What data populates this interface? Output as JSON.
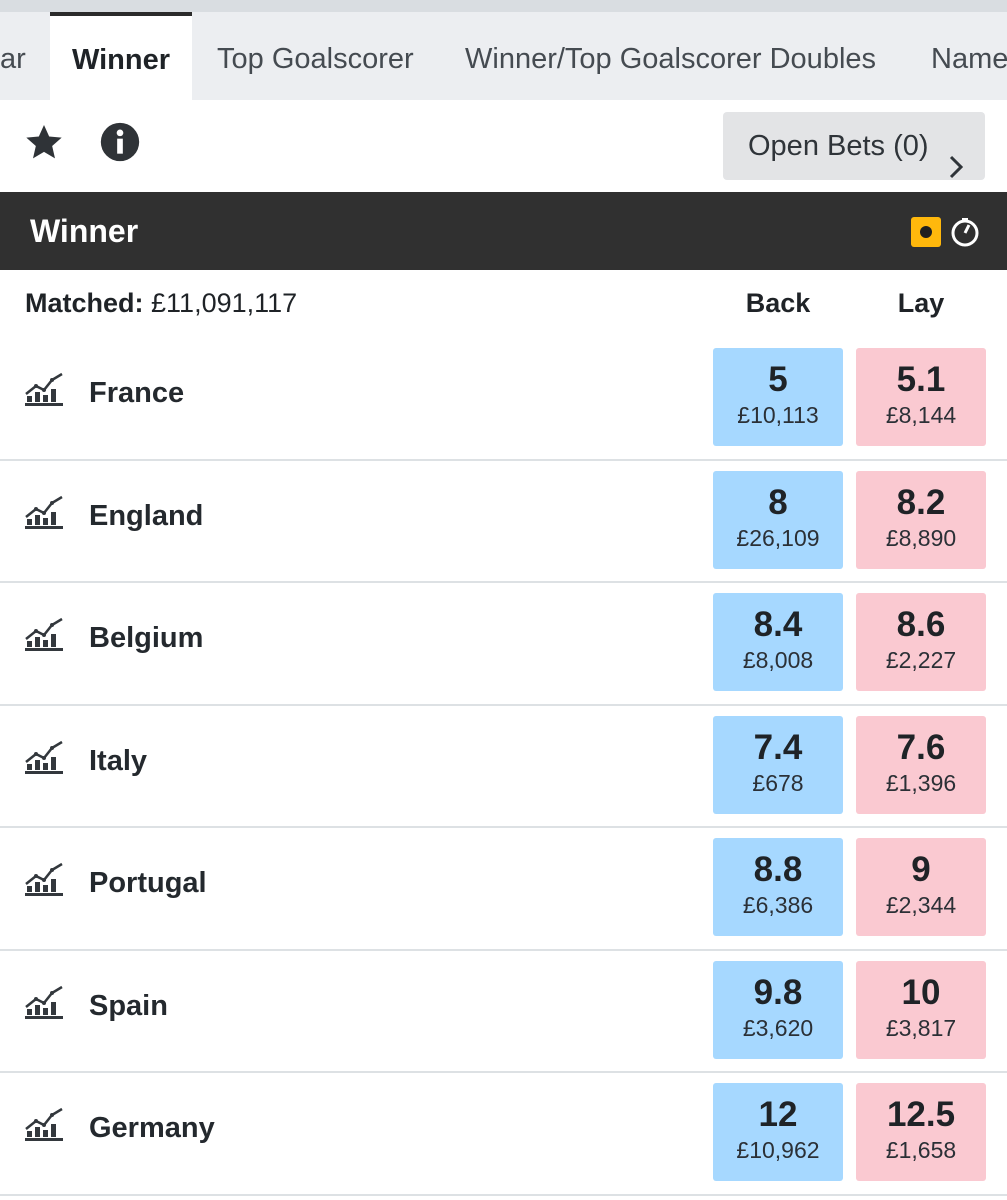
{
  "tabs": [
    {
      "label": "ar",
      "active": false
    },
    {
      "label": "Winner",
      "active": true
    },
    {
      "label": "Top Goalscorer",
      "active": false
    },
    {
      "label": "Winner/Top Goalscorer Doubles",
      "active": false
    },
    {
      "label": "Name",
      "active": false
    }
  ],
  "toolbar": {
    "favourite_icon": "star-icon",
    "info_icon": "info-icon",
    "open_bets_label": "Open Bets (0)"
  },
  "market": {
    "title": "Winner",
    "matched_label": "Matched:",
    "matched_value": "£11,091,117",
    "back_label": "Back",
    "lay_label": "Lay"
  },
  "colors": {
    "back": "#a6d8ff",
    "lay": "#fac9d1",
    "header": "#303030",
    "inplay": "#ffb80c"
  },
  "runners": [
    {
      "name": "France",
      "back_odds": "5",
      "back_stake": "£10,113",
      "lay_odds": "5.1",
      "lay_stake": "£8,144"
    },
    {
      "name": "England",
      "back_odds": "8",
      "back_stake": "£26,109",
      "lay_odds": "8.2",
      "lay_stake": "£8,890"
    },
    {
      "name": "Belgium",
      "back_odds": "8.4",
      "back_stake": "£8,008",
      "lay_odds": "8.6",
      "lay_stake": "£2,227"
    },
    {
      "name": "Italy",
      "back_odds": "7.4",
      "back_stake": "£678",
      "lay_odds": "7.6",
      "lay_stake": "£1,396"
    },
    {
      "name": "Portugal",
      "back_odds": "8.8",
      "back_stake": "£6,386",
      "lay_odds": "9",
      "lay_stake": "£2,344"
    },
    {
      "name": "Spain",
      "back_odds": "9.8",
      "back_stake": "£3,620",
      "lay_odds": "10",
      "lay_stake": "£3,817"
    },
    {
      "name": "Germany",
      "back_odds": "12",
      "back_stake": "£10,962",
      "lay_odds": "12.5",
      "lay_stake": "£1,658"
    }
  ]
}
